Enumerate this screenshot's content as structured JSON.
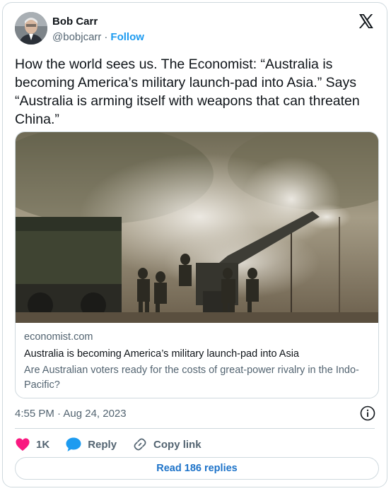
{
  "author": {
    "name": "Bob Carr",
    "handle": "@bobjcarr",
    "separator": "·",
    "follow_label": "Follow"
  },
  "tweet": {
    "text": "How the world sees us. The Economist: “Australia is\nbecoming America’s military launch-pad into Asia.” Says\n“Australia is arming itself with weapons that can threaten\nChina.”"
  },
  "link_card": {
    "domain": "economist.com",
    "title": "Australia is becoming America’s military launch-pad into Asia",
    "description": "Are Australian voters ready for the costs of great-power rivalry in the Indo-Pacific?"
  },
  "meta": {
    "timestamp": "4:55 PM · Aug 24, 2023"
  },
  "actions": {
    "like_count": "1K",
    "reply_label": "Reply",
    "copy_link_label": "Copy link"
  },
  "read_replies_label": "Read 186 replies",
  "colors": {
    "accent": "#1d9bf0",
    "like": "#f91880",
    "text": "#0f1419",
    "muted": "#536471",
    "border": "#cfd9de"
  },
  "icons": [
    "x-logo-icon",
    "info-icon",
    "heart-icon",
    "reply-bubble-icon",
    "link-icon"
  ]
}
